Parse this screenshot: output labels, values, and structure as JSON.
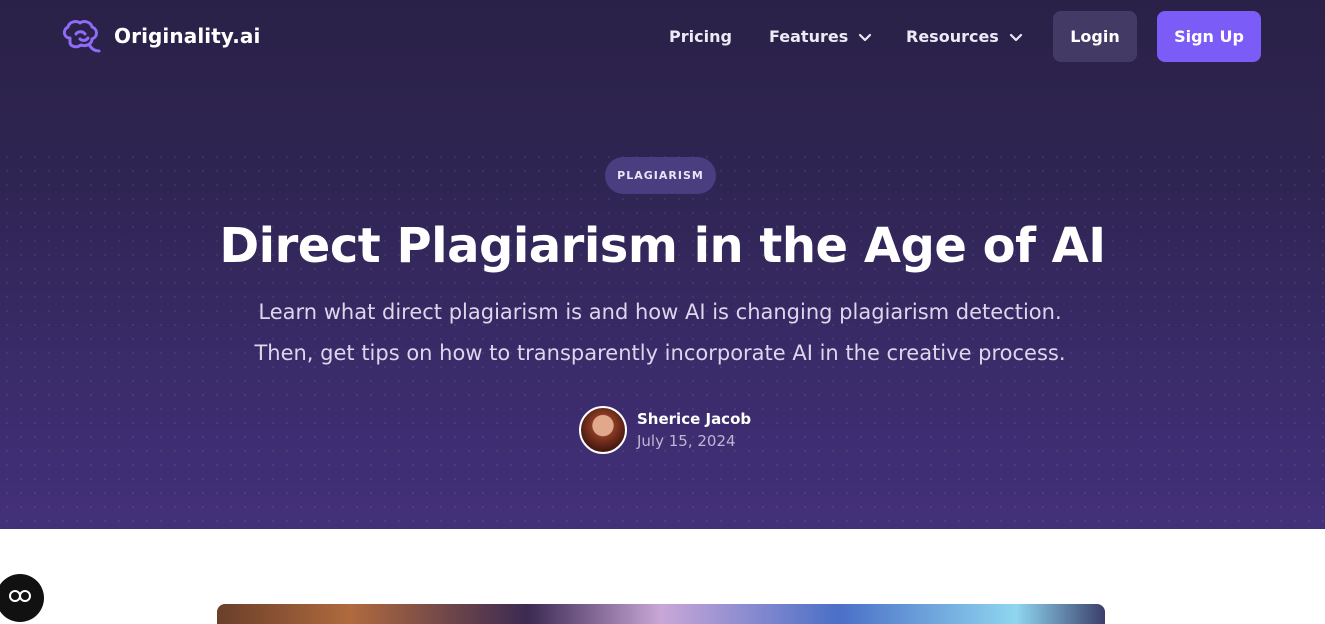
{
  "brand": {
    "name": "Originality.ai"
  },
  "nav": {
    "pricing": "Pricing",
    "features": "Features",
    "resources": "Resources",
    "login": "Login",
    "signup": "Sign Up"
  },
  "hero": {
    "badge": "PLAGIARISM",
    "title": "Direct Plagiarism in the Age of AI",
    "subtitle_line1": "Learn what direct plagiarism is and how AI is changing plagiarism detection.",
    "subtitle_line2": "Then, get tips on how to transparently incorporate AI in the creative process.",
    "author_name": "Sherice Jacob",
    "author_date": "July 15, 2024"
  },
  "colors": {
    "accent": "#7b5cf6",
    "hero_bg": "#2f2553",
    "login_bg": "#433a66"
  },
  "icons": [
    "brain-logo-icon",
    "chevron-down-icon",
    "accessibility-icon"
  ]
}
